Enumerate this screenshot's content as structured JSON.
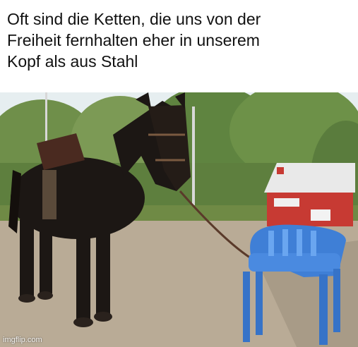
{
  "meme": {
    "caption_lines": [
      "Oft sind die Ketten, die uns von der",
      "Freiheit fernhalten eher in unserem",
      "Kopf als aus Stahl"
    ],
    "watermark": "imgflip.com"
  },
  "photo": {
    "subject": "horse tied to a blue plastic chair",
    "colors": {
      "sky": "#e6eef0",
      "trees": "#6f8f4a",
      "pavement": "#b9ab96",
      "horse": "#1c1714",
      "chair": "#3f7fd6",
      "kiosk_roof": "#e9e9e9",
      "kiosk_red": "#c73a33"
    }
  }
}
